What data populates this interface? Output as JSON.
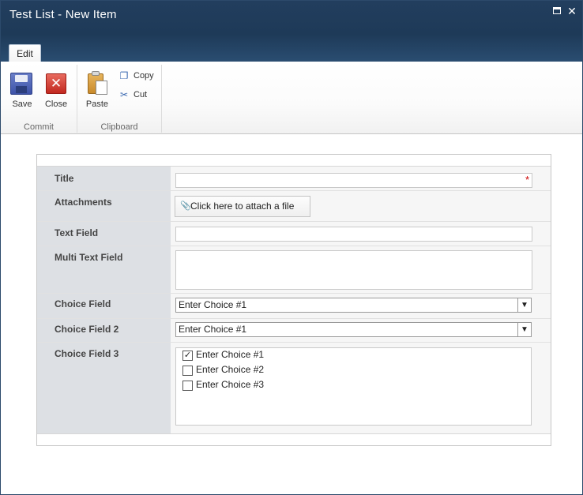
{
  "window": {
    "title": "Test List - New Item",
    "maximize_glyph": "",
    "close_glyph": "✕"
  },
  "ribbon": {
    "tab": "Edit",
    "groups": {
      "commit": {
        "label": "Commit",
        "save_label": "Save",
        "close_label": "Close",
        "close_glyph": "✕"
      },
      "clipboard": {
        "label": "Clipboard",
        "paste_label": "Paste",
        "copy_label": "Copy",
        "cut_label": "Cut",
        "copy_glyph": "❐",
        "cut_glyph": "✂"
      }
    }
  },
  "form": {
    "fields": {
      "title": {
        "label": "Title",
        "value": "",
        "required_mark": "*"
      },
      "attachments": {
        "label": "Attachments",
        "button_label": "Click here to attach a file",
        "clip_glyph": "🖇"
      },
      "text_field": {
        "label": "Text Field",
        "value": ""
      },
      "multi_text_field": {
        "label": "Multi Text Field",
        "value": ""
      },
      "choice_field": {
        "label": "Choice Field",
        "selected": "Enter Choice #1",
        "arrow": "▼"
      },
      "choice_field_2": {
        "label": "Choice Field 2",
        "selected": "Enter Choice #1",
        "arrow": "▼"
      },
      "choice_field_3": {
        "label": "Choice Field 3",
        "options": [
          {
            "label": "Enter Choice #1",
            "checked": true,
            "mark": "✓"
          },
          {
            "label": "Enter Choice #2",
            "checked": false,
            "mark": ""
          },
          {
            "label": "Enter Choice #3",
            "checked": false,
            "mark": ""
          }
        ]
      }
    }
  },
  "colors": {
    "titlebar": "#1e3a58",
    "label_column": "#dde0e4",
    "required": "#cc0000"
  }
}
